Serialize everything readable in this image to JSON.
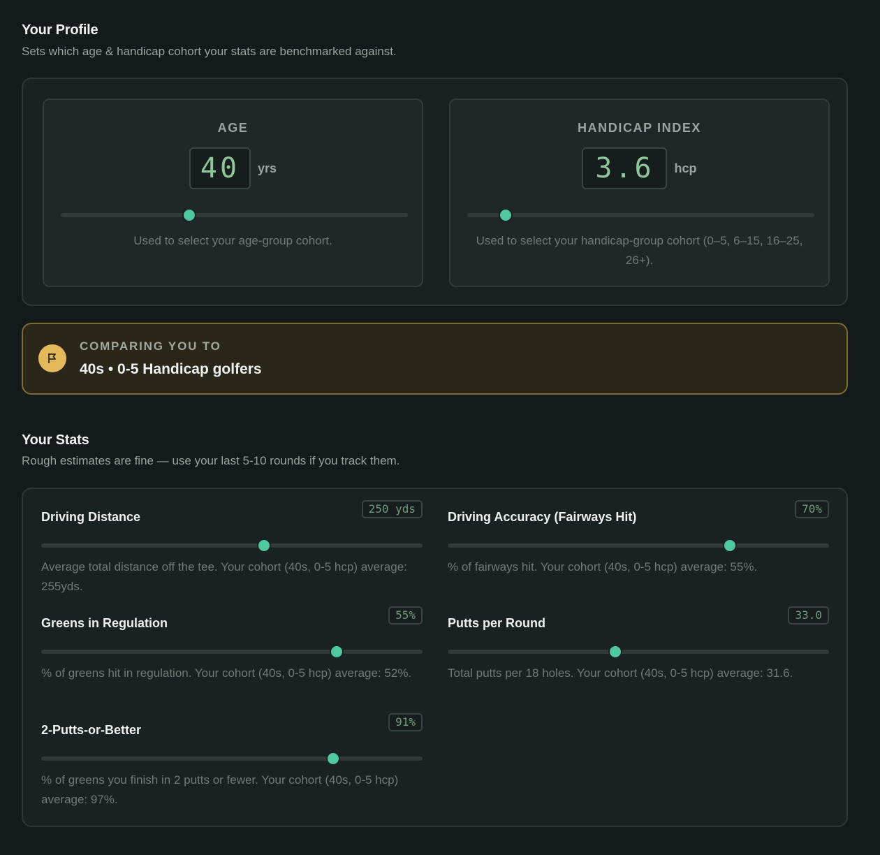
{
  "profile": {
    "title": "Your Profile",
    "subtitle": "Sets which age & handicap cohort your stats are benchmarked against.",
    "age": {
      "label": "AGE",
      "value": "40",
      "unit": "yrs",
      "slider_fraction": 0.37,
      "help": "Used to select your age-group cohort."
    },
    "handicap": {
      "label": "HANDICAP INDEX",
      "value": "3.6",
      "unit": "hcp",
      "slider_fraction": 0.11,
      "help": "Used to select your handicap-group cohort (0–5, 6–15, 16–25, 26+)."
    }
  },
  "comparison": {
    "label": "COMPARING YOU TO",
    "value": "40s • 0-5 Handicap golfers",
    "icon": "flag-icon"
  },
  "stats": {
    "title": "Your Stats",
    "subtitle": "Rough estimates are fine — use your last 5-10 rounds if you track them.",
    "items": [
      {
        "name": "Driving Distance",
        "value": "250 yds",
        "slider_fraction": 0.585,
        "help": "Average total distance off the tee. Your cohort (40s, 0-5 hcp) average: 255yds."
      },
      {
        "name": "Driving Accuracy (Fairways Hit)",
        "value": "70%",
        "slider_fraction": 0.74,
        "help": "% of fairways hit. Your cohort (40s, 0-5 hcp) average: 55%."
      },
      {
        "name": "Greens in Regulation",
        "value": "55%",
        "slider_fraction": 0.775,
        "help": "% of greens hit in regulation. Your cohort (40s, 0-5 hcp) average: 52%."
      },
      {
        "name": "Putts per Round",
        "value": "33.0",
        "slider_fraction": 0.44,
        "help": "Total putts per 18 holes. Your cohort (40s, 0-5 hcp) average: 31.6."
      },
      {
        "name": "2-Putts-or-Better",
        "value": "91%",
        "slider_fraction": 0.765,
        "help": "% of greens you finish in 2 putts or fewer. Your cohort (40s, 0-5 hcp) average: 97%."
      }
    ]
  },
  "colors": {
    "accent": "#4fc79f",
    "lcd_text": "#8fc79b",
    "compare_border": "#7e6a35",
    "flag_badge": "#e4b95b"
  }
}
